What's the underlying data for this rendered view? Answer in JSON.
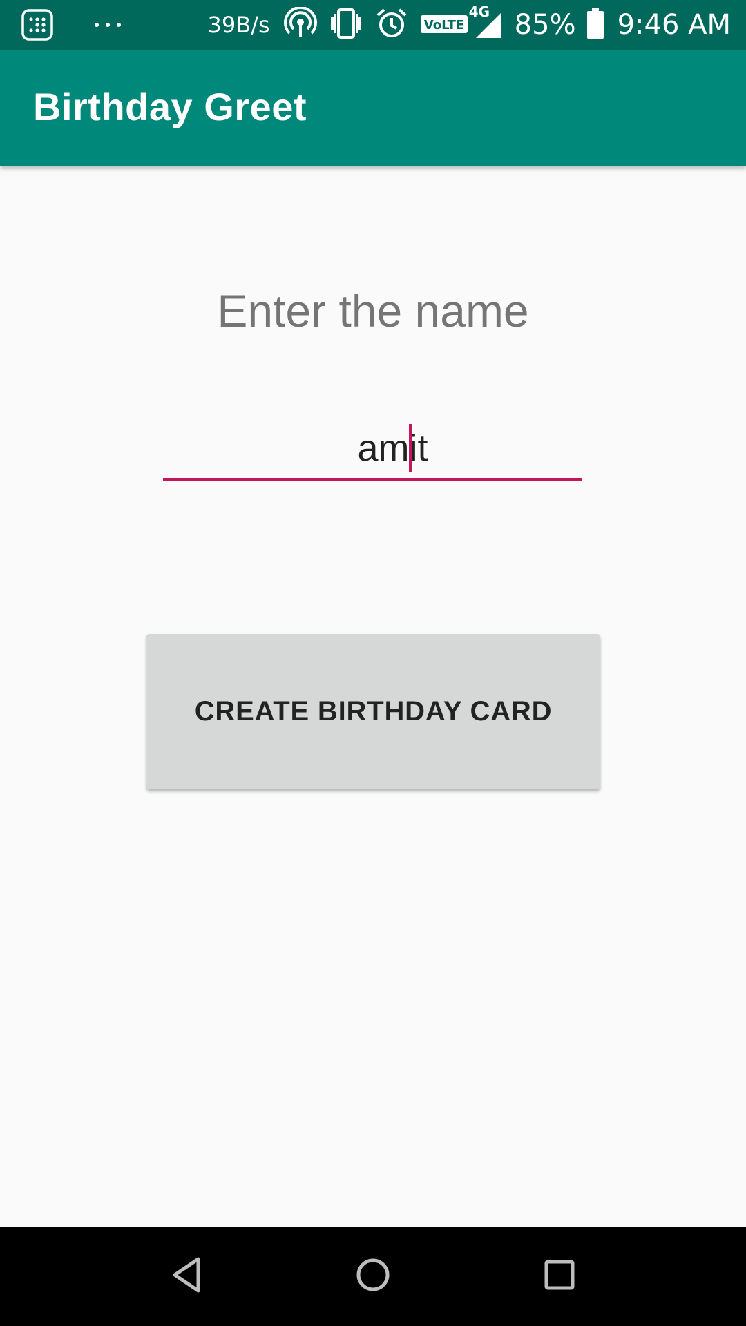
{
  "status_bar": {
    "network_speed": "39B/s",
    "battery_percent": "85%",
    "time": "9:46 AM",
    "volte_label": "VoLTE",
    "network_type": "4G",
    "icons": [
      "app-grid-icon",
      "more-dots-icon",
      "hotspot-icon",
      "vibrate-icon",
      "alarm-icon",
      "volte-icon",
      "signal-icon",
      "battery-icon"
    ]
  },
  "app_bar": {
    "title": "Birthday Greet"
  },
  "form": {
    "prompt": "Enter the name",
    "name_value": "amit"
  },
  "actions": {
    "create_label": "CREATE BIRTHDAY CARD"
  },
  "nav_bar": {
    "icons": [
      "back-icon",
      "home-icon",
      "recents-icon"
    ]
  },
  "colors": {
    "status_bar": "#00695c",
    "app_bar": "#00897b",
    "accent": "#c2185b",
    "button": "#d6d7d7",
    "background": "#fafafa"
  }
}
